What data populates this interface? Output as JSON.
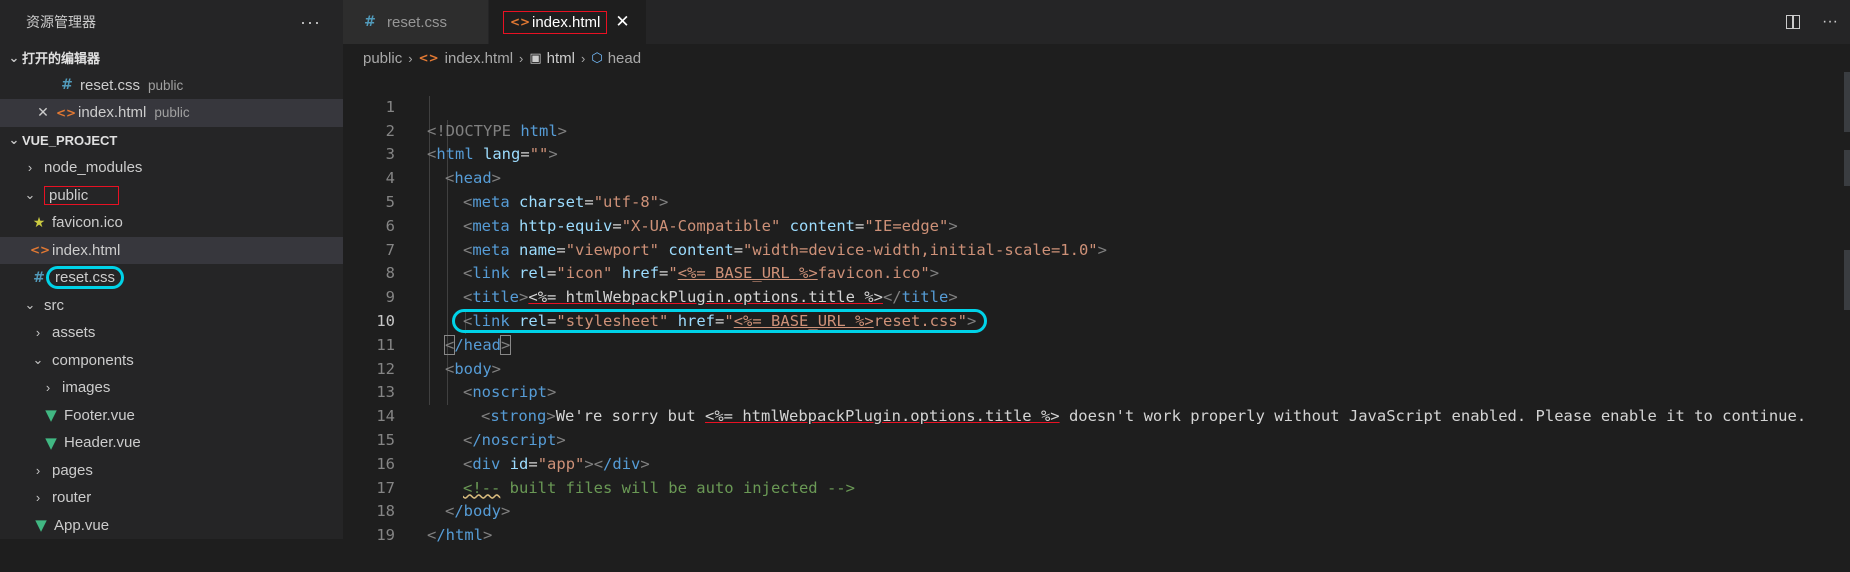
{
  "sidebar": {
    "title": "资源管理器",
    "more": "···",
    "open_editors": {
      "label": "打开的编辑器",
      "items": [
        {
          "name": "reset.css",
          "desc": "public",
          "icon": "css-file-icon"
        },
        {
          "name": "index.html",
          "desc": "public",
          "icon": "html-file-icon"
        }
      ]
    },
    "project": {
      "label": "VUE_PROJECT",
      "node_modules": "node_modules",
      "public": "public",
      "favicon": "favicon.ico",
      "index_html": "index.html",
      "reset_css": "reset.css",
      "src": "src",
      "assets": "assets",
      "components": "components",
      "images": "images",
      "footer": "Footer.vue",
      "header": "Header.vue",
      "pages": "pages",
      "router": "router",
      "app": "App.vue"
    }
  },
  "tabs": [
    {
      "label": "reset.css",
      "active": false
    },
    {
      "label": "index.html",
      "active": true
    }
  ],
  "breadcrumb": {
    "public": "public",
    "file": "index.html",
    "html": "html",
    "head": "head"
  },
  "code": {
    "current_line": 10,
    "line_numbers": [
      "1",
      "2",
      "3",
      "4",
      "5",
      "6",
      "7",
      "8",
      "9",
      "10",
      "11",
      "12",
      "13",
      "14",
      "15",
      "16",
      "17",
      "18",
      "19"
    ],
    "l1": {
      "a": "<!DOCTYPE",
      "b": " html",
      "c": ">"
    },
    "l2": {
      "a": "<",
      "b": "html",
      "c": " lang",
      "d": "=",
      "e": "\"\"",
      "f": ">"
    },
    "l3": {
      "a": "<",
      "b": "head",
      "c": ">"
    },
    "l4": {
      "tag": "meta",
      "attr": "charset",
      "val": "\"utf-8\""
    },
    "l5": {
      "tag": "meta",
      "attr1": "http-equiv",
      "val1": "\"X-UA-Compatible\"",
      "attr2": "content",
      "val2": "\"IE=edge\""
    },
    "l6": {
      "tag": "meta",
      "attr1": "name",
      "val1": "\"viewport\"",
      "attr2": "content",
      "val2": "\"width=device-width,initial-scale=1.0\""
    },
    "l7": {
      "tag": "link",
      "attr1": "rel",
      "val1": "\"icon\"",
      "attr2": "href",
      "val2a": "\"",
      "ejs": "<%= BASE_URL %>",
      "val2b": "favicon.ico\""
    },
    "l8": {
      "tag": "title",
      "ejs": "<%= htmlWebpackPlugin.options.title %>",
      "close": "title"
    },
    "l9": {
      "tag": "link",
      "attr1": "rel",
      "val1": "\"stylesheet\"",
      "attr2": "href",
      "val2a": "\"",
      "ejs": "<%= BASE_URL %>",
      "val2b": "reset.css\""
    },
    "l10": {
      "a": "<",
      "b": "/head",
      "c": ">"
    },
    "l11": {
      "tag": "body"
    },
    "l12": {
      "tag": "noscript"
    },
    "l13": {
      "tag": "strong",
      "t1": "We're sorry but ",
      "ejs": "<%= htmlWebpackPlugin.options.title %>",
      "t2": " doesn't work properly without JavaScript enabled. Please enable it to continue."
    },
    "l14": {
      "tag": "/noscript"
    },
    "l15": {
      "tag": "div",
      "attr": "id",
      "val": "\"app\"",
      "close": "/div"
    },
    "l16": {
      "open": "<!--",
      "text": " built files will be auto injected ",
      "close": "-->"
    },
    "l17": {
      "tag": "/body"
    },
    "l18": {
      "tag": "/html"
    }
  },
  "colors": {
    "annotation_red": "#e81123",
    "annotation_cyan": "#00d3e8"
  }
}
